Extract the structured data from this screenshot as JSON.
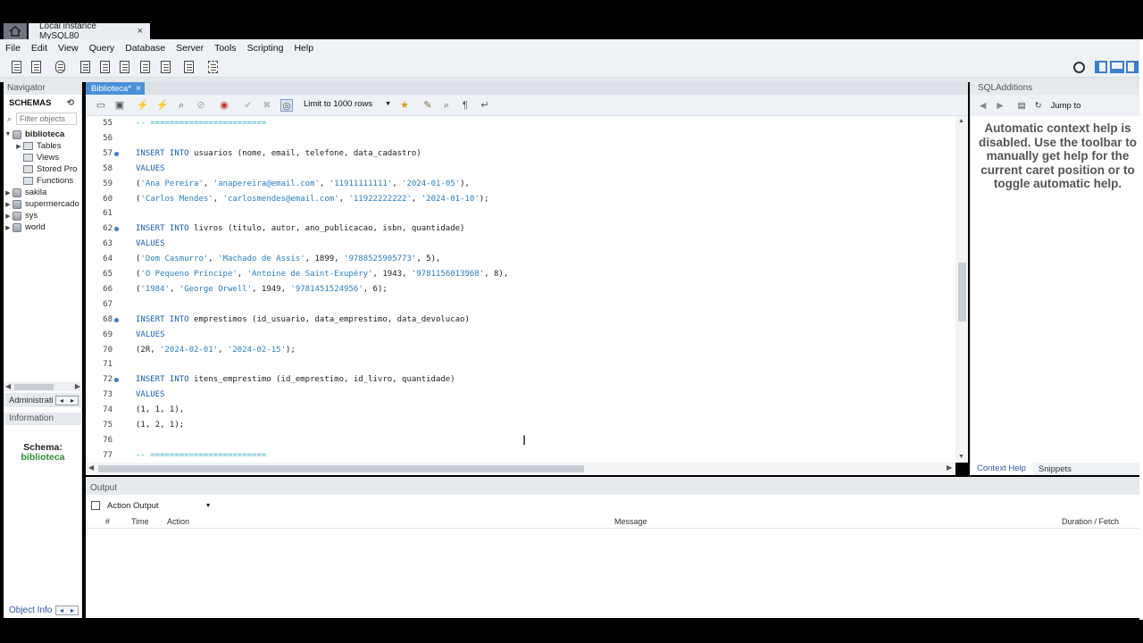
{
  "window": {
    "connection_tab": "Local instance MySQL80",
    "close_glyph": "×"
  },
  "menu": [
    "File",
    "Edit",
    "View",
    "Query",
    "Database",
    "Server",
    "Tools",
    "Scripting",
    "Help"
  ],
  "navigator": {
    "header": "Navigator",
    "schemas_label": "SCHEMAS",
    "filter_placeholder": "Filter objects",
    "tree": [
      {
        "label": "biblioteca",
        "expanded": true,
        "bold": true
      },
      {
        "label": "Tables",
        "child": true
      },
      {
        "label": "Views",
        "child": true
      },
      {
        "label": "Stored Pro",
        "child": true
      },
      {
        "label": "Functions",
        "child": true
      },
      {
        "label": "sakila"
      },
      {
        "label": "supermercado"
      },
      {
        "label": "sys"
      },
      {
        "label": "world"
      }
    ],
    "administration_label": "Administrati",
    "information_header": "Information",
    "schema_info_label": "Schema:",
    "schema_info_value": "biblioteca",
    "object_info_label": "Object Info"
  },
  "editor": {
    "tab_label": "Biblioteca*",
    "limit_label": "Limit to 1000 rows",
    "lines": [
      {
        "n": "55",
        "dot": false,
        "html": "<span class=\"cmt\">-- ========================</span>"
      },
      {
        "n": "56",
        "dot": false,
        "html": ""
      },
      {
        "n": "57",
        "dot": true,
        "html": "<span class=\"kw\">INSERT INTO</span> usuarios (nome, email, telefone, data_cadastro)"
      },
      {
        "n": "58",
        "dot": false,
        "html": "<span class=\"kw\">VALUES</span>"
      },
      {
        "n": "59",
        "dot": false,
        "html": "(<span class=\"str\">'Ana Pereira'</span>, <span class=\"str\">'anapereira@email.com'</span>, <span class=\"str\">'11911111111'</span>, <span class=\"str\">'2024-01-05'</span>),"
      },
      {
        "n": "60",
        "dot": false,
        "html": "(<span class=\"str\">'Carlos Mendes'</span>, <span class=\"str\">'carlosmendes@email.com'</span>, <span class=\"str\">'11922222222'</span>, <span class=\"str\">'2024-01-10'</span>);"
      },
      {
        "n": "61",
        "dot": false,
        "html": ""
      },
      {
        "n": "62",
        "dot": true,
        "html": "<span class=\"kw\">INSERT INTO</span> livros (titulo, autor, ano_publicacao, isbn, quantidade)"
      },
      {
        "n": "63",
        "dot": false,
        "html": "<span class=\"kw\">VALUES</span>"
      },
      {
        "n": "64",
        "dot": false,
        "html": "(<span class=\"str\">'Dom Casmurro'</span>, <span class=\"str\">'Machado de Assis'</span>, 1899, <span class=\"str\">'9788525905773'</span>, 5),"
      },
      {
        "n": "65",
        "dot": false,
        "html": "(<span class=\"str\">'O Pequeno Príncipe'</span>, <span class=\"str\">'Antoine de Saint-Exupéry'</span>, 1943, <span class=\"str\">'9781156013968'</span>, 8),"
      },
      {
        "n": "66",
        "dot": false,
        "html": "(<span class=\"str\">'1984'</span>, <span class=\"str\">'George Orwell'</span>, 1949, <span class=\"str\">'9781451524956'</span>, 6);"
      },
      {
        "n": "67",
        "dot": false,
        "html": ""
      },
      {
        "n": "68",
        "dot": true,
        "html": "<span class=\"kw\">INSERT INTO</span> emprestimos (id_usuario, data_emprestimo, data_devolucao)"
      },
      {
        "n": "69",
        "dot": false,
        "html": "<span class=\"kw\">VALUES</span>"
      },
      {
        "n": "70",
        "dot": false,
        "html": "(2R, <span class=\"str\">'2024-02-01'</span>, <span class=\"str\">'2024-02-15'</span>);"
      },
      {
        "n": "71",
        "dot": false,
        "html": ""
      },
      {
        "n": "72",
        "dot": true,
        "html": "<span class=\"kw\">INSERT INTO</span> itens_emprestimo (id_emprestimo, id_livro, quantidade)"
      },
      {
        "n": "73",
        "dot": false,
        "html": "<span class=\"kw\">VALUES</span>"
      },
      {
        "n": "74",
        "dot": false,
        "html": "(1, 1, 1),"
      },
      {
        "n": "75",
        "dot": false,
        "html": "(1, 2, 1);"
      },
      {
        "n": "76",
        "dot": false,
        "html": ""
      },
      {
        "n": "77",
        "dot": false,
        "html": "<span class=\"cmt\">-- ========================</span>"
      }
    ]
  },
  "sql_additions": {
    "header": "SQLAdditions",
    "jump_to": "Jump to",
    "help_text": "Automatic context help is disabled. Use the toolbar to manually get help for the current caret position or to toggle automatic help.",
    "tabs": [
      "Context Help",
      "Snippets"
    ]
  },
  "output": {
    "header": "Output",
    "selector": "Action Output",
    "columns": [
      "#",
      "Time",
      "Action",
      "Message",
      "Duration / Fetch"
    ]
  }
}
